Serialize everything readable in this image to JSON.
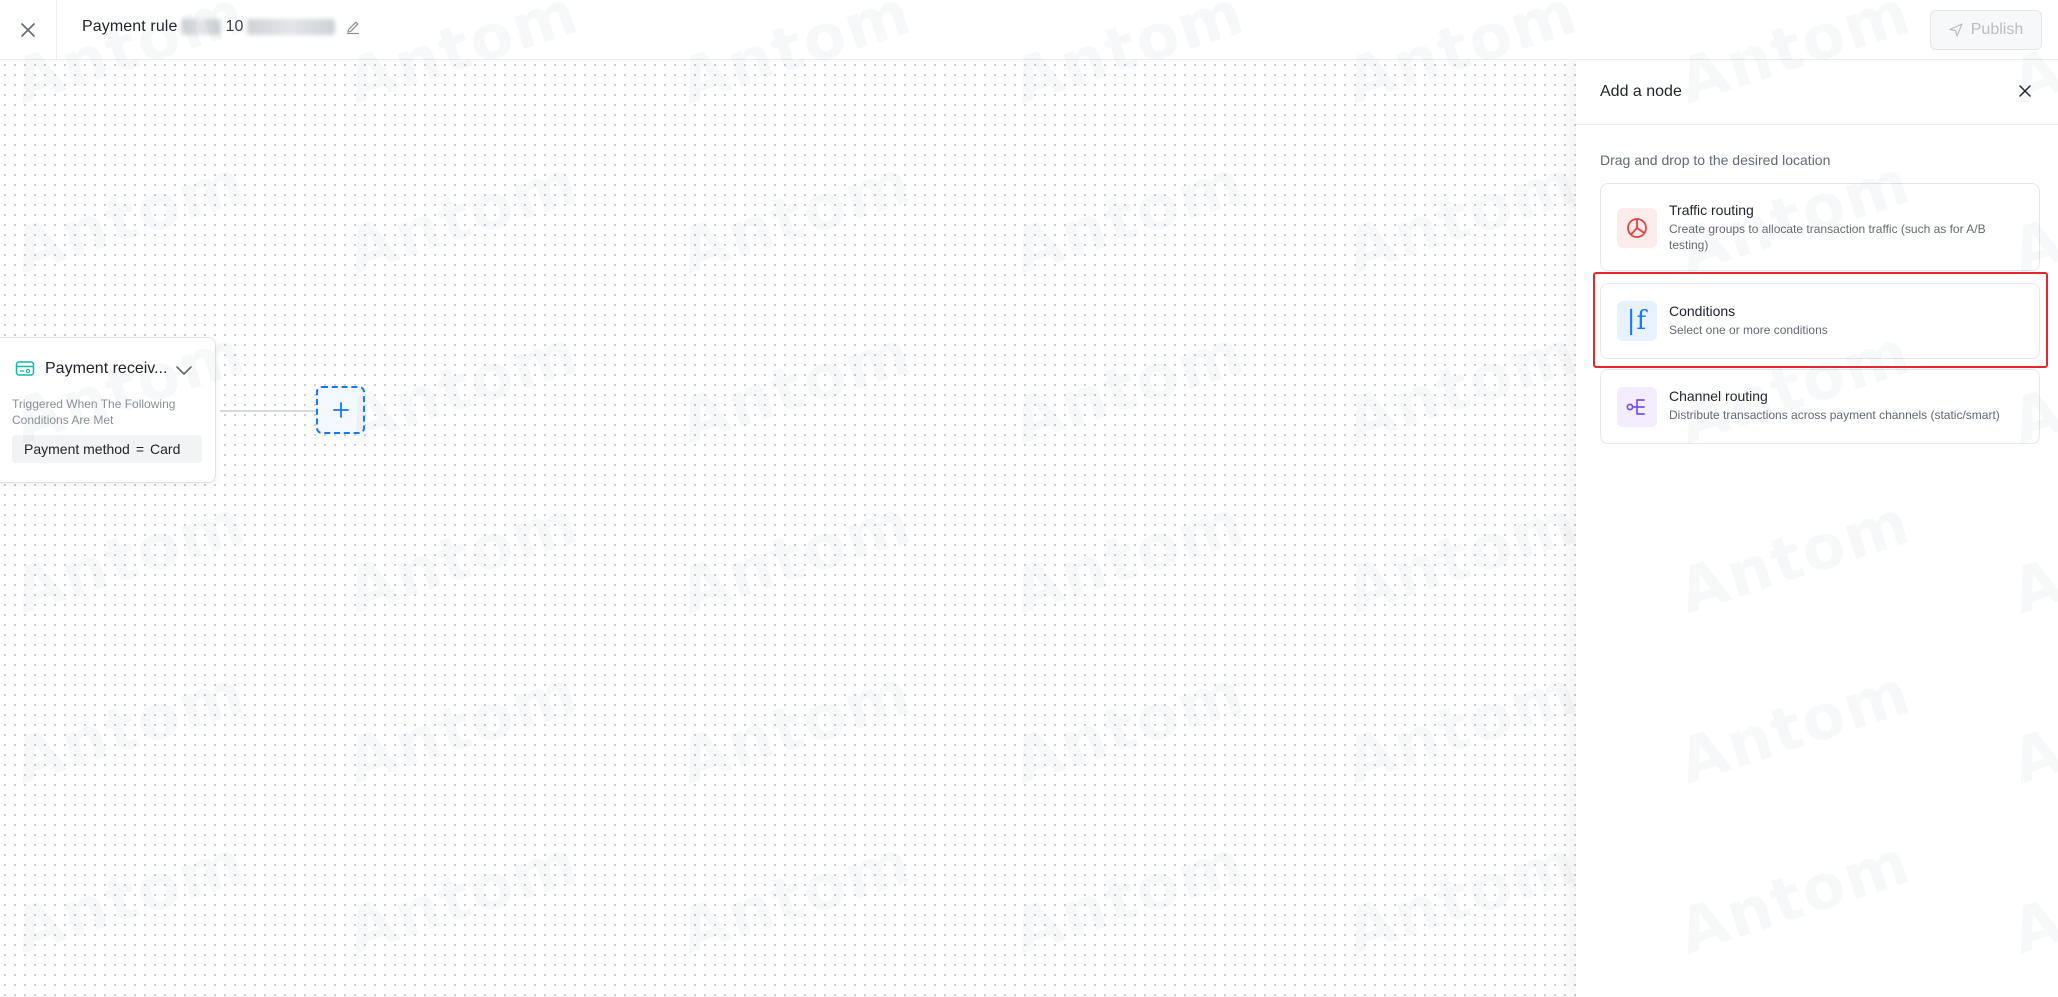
{
  "header": {
    "title": "Payment rule",
    "title_suffix_visible": "10",
    "publish_label": "Publish"
  },
  "canvas": {
    "trigger_node": {
      "title": "Payment receiv...",
      "subtitle": "Triggered When The Following Conditions Are Met",
      "condition": {
        "field": "Payment method",
        "operator": "=",
        "value": "Card"
      }
    }
  },
  "watermark": {
    "text": "Antom"
  },
  "panel": {
    "title": "Add a node",
    "hint": "Drag and drop to the desired location",
    "nodes": [
      {
        "title": "Traffic routing",
        "description": "Create groups to allocate transaction traffic (such as for A/B testing)",
        "icon": "pie-chart-icon",
        "icon_color": "#e8413e"
      },
      {
        "title": "Conditions",
        "description": "Select one or more conditions",
        "icon": "if-icon",
        "icon_color": "#1677ff",
        "highlighted": true
      },
      {
        "title": "Channel routing",
        "description": "Distribute transactions across payment channels (static/smart)",
        "icon": "branch-icon",
        "icon_color": "#7a4ff0"
      }
    ]
  },
  "colors": {
    "accent": "#1677ff",
    "highlight": "#e8262b",
    "trigger_icon": "#14b8a6"
  }
}
